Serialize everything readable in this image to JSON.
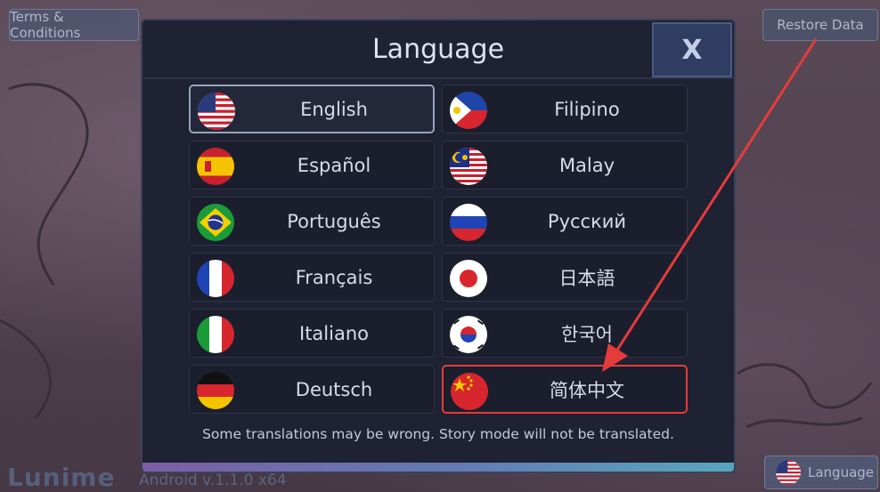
{
  "topbar": {
    "terms_label": "Terms & Conditions",
    "restore_label": "Restore Data"
  },
  "brand": {
    "logo": "Lunime",
    "version": "Android v.1.1.0 x64"
  },
  "language_button": {
    "label": "Language",
    "icon": "us-flag-icon"
  },
  "modal": {
    "title": "Language",
    "close_label": "X",
    "disclaimer": "Some translations may be wrong. Story mode will not be translated.",
    "languages": [
      {
        "label": "English",
        "flag": "us-flag-icon",
        "selected": true
      },
      {
        "label": "Filipino",
        "flag": "philippines-flag-icon"
      },
      {
        "label": "Español",
        "flag": "spain-flag-icon"
      },
      {
        "label": "Malay",
        "flag": "malaysia-flag-icon"
      },
      {
        "label": "Português",
        "flag": "brazil-flag-icon"
      },
      {
        "label": "Русский",
        "flag": "russia-flag-icon"
      },
      {
        "label": "Français",
        "flag": "france-flag-icon"
      },
      {
        "label": "日本語",
        "flag": "japan-flag-icon"
      },
      {
        "label": "Italiano",
        "flag": "italy-flag-icon"
      },
      {
        "label": "한국어",
        "flag": "korea-flag-icon"
      },
      {
        "label": "Deutsch",
        "flag": "germany-flag-icon"
      },
      {
        "label": "简体中文",
        "flag": "china-flag-icon",
        "highlighted": true
      }
    ]
  },
  "colors": {
    "modal_bg": "#1e2233",
    "highlight": "#e63b3b",
    "accent_gradient_start": "#7c5ea6",
    "accent_gradient_end": "#58a6bd"
  }
}
